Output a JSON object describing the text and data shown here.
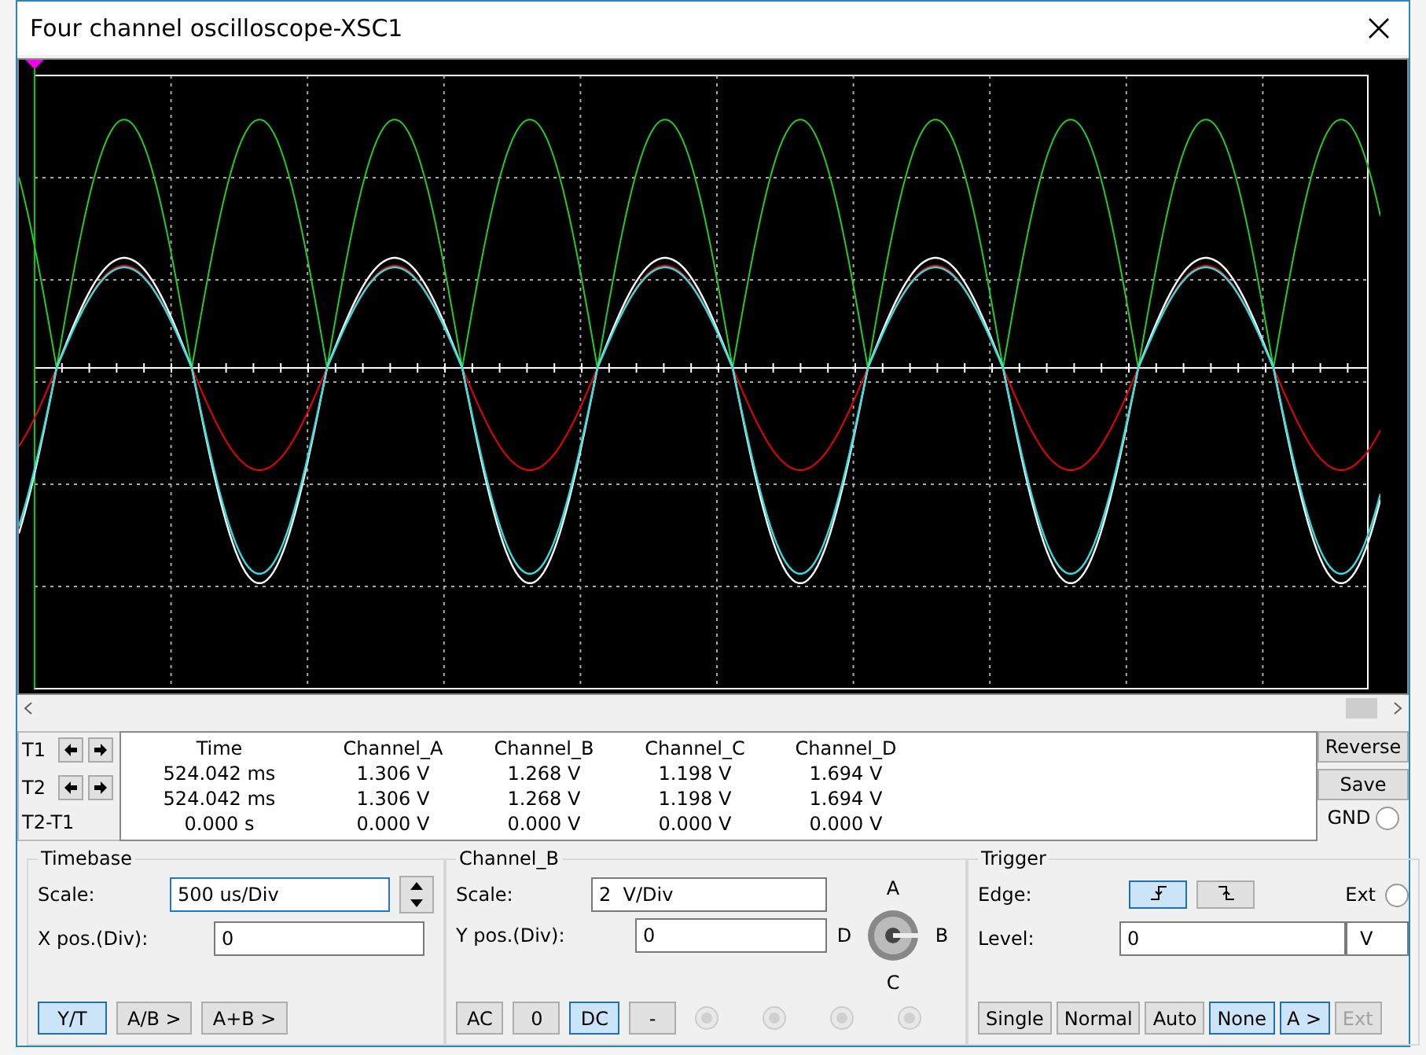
{
  "window": {
    "title": "Four channel oscilloscope-XSC1"
  },
  "readout": {
    "columns": [
      "Time",
      "Channel_A",
      "Channel_B",
      "Channel_C",
      "Channel_D"
    ],
    "rows": [
      {
        "label": "T1",
        "kind": "cursor",
        "cells": [
          "524.042 ms",
          "1.306 V",
          "1.268 V",
          "1.198 V",
          "1.694 V"
        ]
      },
      {
        "label": "T2",
        "kind": "cursor",
        "cells": [
          "524.042 ms",
          "1.306 V",
          "1.268 V",
          "1.198 V",
          "1.694 V"
        ]
      },
      {
        "label": "T2-T1",
        "kind": "difference",
        "cells": [
          "0.000 s",
          "0.000 V",
          "0.000 V",
          "0.000 V",
          "0.000 V"
        ]
      }
    ]
  },
  "side_buttons": [
    "Reverse",
    "Save"
  ],
  "gnd": {
    "label": "GND",
    "selected": false
  },
  "timebase": {
    "title": "Timebase",
    "scale_label": "Scale:",
    "scale_value": "500 us/Div",
    "xpos_label": "X pos.(Div):",
    "xpos_value": "0",
    "modes": [
      {
        "label": "Y/T",
        "selected": true
      },
      {
        "label": "A/B >",
        "selected": false
      },
      {
        "label": "A+B >",
        "selected": false
      }
    ]
  },
  "channel": {
    "title": "Channel_B",
    "scale_label": "Scale:",
    "scale_value": "2  V/Div",
    "ypos_label": "Y pos.(Div):",
    "ypos_value": "0",
    "coupling": [
      {
        "label": "AC",
        "selected": false
      },
      {
        "label": "0",
        "selected": false
      },
      {
        "label": "DC",
        "selected": true
      },
      {
        "label": "-",
        "selected": false
      }
    ],
    "knob_labels": [
      "A",
      "B",
      "C",
      "D"
    ],
    "channel_radios": [
      {
        "selected": false
      },
      {
        "selected": false
      },
      {
        "selected": false
      },
      {
        "selected": false
      }
    ]
  },
  "trigger": {
    "title": "Trigger",
    "edge_label": "Edge:",
    "edges": [
      {
        "kind": "rising",
        "selected": true
      },
      {
        "kind": "falling",
        "selected": false
      }
    ],
    "ext_label": "Ext",
    "ext_selected": false,
    "level_label": "Level:",
    "level_value": "0",
    "level_unit": "V",
    "buttons": [
      {
        "label": "Single",
        "selected": false,
        "disabled": false
      },
      {
        "label": "Normal",
        "selected": false,
        "disabled": false
      },
      {
        "label": "Auto",
        "selected": false,
        "disabled": false
      },
      {
        "label": "None",
        "selected": true,
        "disabled": false
      },
      {
        "label": "A >",
        "selected": true,
        "disabled": false
      },
      {
        "label": "Ext",
        "selected": false,
        "disabled": true
      }
    ]
  }
}
